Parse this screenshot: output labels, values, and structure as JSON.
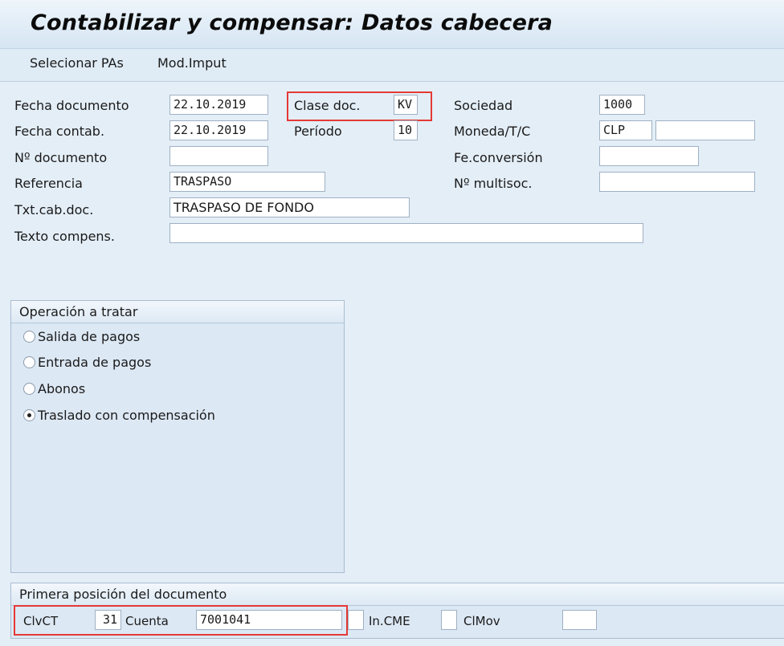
{
  "title": "Contabilizar y compensar: Datos cabecera",
  "toolbar": {
    "select_items": "Selecionar PAs",
    "mod_input": "Mod.Imput"
  },
  "header": {
    "fecha_documento": {
      "label": "Fecha documento",
      "value": "22.10.2019"
    },
    "fecha_contab": {
      "label": "Fecha contab.",
      "value": "22.10.2019"
    },
    "n_documento": {
      "label": "Nº documento",
      "value": ""
    },
    "referencia": {
      "label": "Referencia",
      "value": "TRASPASO"
    },
    "txt_cab_doc": {
      "label": "Txt.cab.doc.",
      "value": "TRASPASO DE FONDO"
    },
    "texto_compens": {
      "label": "Texto compens.",
      "value": ""
    },
    "clase_doc": {
      "label": "Clase doc.",
      "value": "KV"
    },
    "periodo": {
      "label": "Período",
      "value": "10"
    },
    "sociedad": {
      "label": "Sociedad",
      "value": "1000"
    },
    "moneda": {
      "label": "Moneda/T/C",
      "value": "CLP",
      "rate": ""
    },
    "fe_conversion": {
      "label": "Fe.conversión",
      "value": ""
    },
    "n_multisoc": {
      "label": "Nº multisoc.",
      "value": ""
    }
  },
  "operation": {
    "title": "Operación a tratar",
    "options": [
      {
        "label": "Salida de pagos",
        "selected": false
      },
      {
        "label": "Entrada de pagos",
        "selected": false
      },
      {
        "label": "Abonos",
        "selected": false
      },
      {
        "label": "Traslado con compensación",
        "selected": true
      }
    ]
  },
  "first_item": {
    "title": "Primera posición del documento",
    "clvct_label": "ClvCT",
    "clvct_value": "31",
    "cuenta_label": "Cuenta",
    "cuenta_value": "7001041",
    "incme_label": "In.CME",
    "incme_value": "",
    "clmov_label": "ClMov",
    "clmov_value": ""
  },
  "colors": {
    "highlight": "#e53935",
    "background": "#dfebf5"
  }
}
